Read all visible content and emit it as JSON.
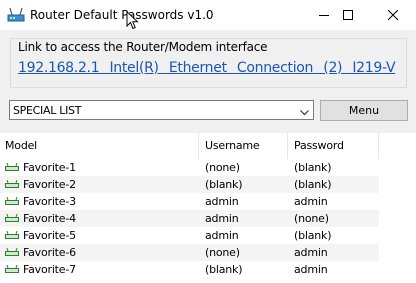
{
  "window": {
    "title": "Router Default Passwords v1.0",
    "icon": "network-router-icon"
  },
  "interface_group": {
    "label": "Link to access the Router/Modem interface",
    "link_text": "192.168.2.1   Intel(R) Ethernet Connection (2) I219-V"
  },
  "toolbar": {
    "list_selected": "SPECIAL LIST",
    "menu_label": "Menu"
  },
  "table": {
    "columns": [
      "Model",
      "Username",
      "Password"
    ],
    "rows": [
      {
        "model": "Favorite-1",
        "username": "(none)",
        "password": "(blank)"
      },
      {
        "model": "Favorite-2",
        "username": "(blank)",
        "password": "(blank)"
      },
      {
        "model": "Favorite-3",
        "username": "admin",
        "password": "admin"
      },
      {
        "model": "Favorite-4",
        "username": "admin",
        "password": "(none)"
      },
      {
        "model": "Favorite-5",
        "username": "admin",
        "password": "(blank)"
      },
      {
        "model": "Favorite-6",
        "username": "(none)",
        "password": "admin"
      },
      {
        "model": "Favorite-7",
        "username": "(blank)",
        "password": "admin"
      }
    ]
  },
  "colors": {
    "link": "#1a56b4",
    "row_alt": "#f4f4f4",
    "background": "#f0f0f0"
  }
}
